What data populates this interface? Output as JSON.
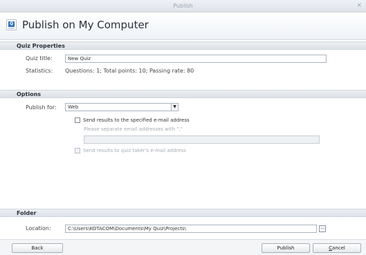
{
  "window": {
    "title": "Publish",
    "close_glyph": "×"
  },
  "header": {
    "icon": "quiz-app-icon",
    "icon_letter": "Q",
    "title": "Publish on My Computer"
  },
  "quiz_properties": {
    "section_title": "Quiz Properties",
    "quiz_title_label": "Quiz title:",
    "quiz_title_value": "New Quiz",
    "statistics_label": "Statistics:",
    "statistics_value": "Questions: 1;   Total points: 10;   Passing rate: 80"
  },
  "options": {
    "section_title": "Options",
    "publish_for_label": "Publish for:",
    "publish_for_value": "Web",
    "send_results_label": "Send results to the specified e-mail address",
    "email_hint": "Please separate email addresses with \",\"",
    "email_value": "",
    "send_taker_label": "Send results to quiz taker's e-mail address"
  },
  "folder": {
    "section_title": "Folder",
    "location_label": "Location:",
    "location_value": "C:\\Users\\KOTACOM\\Documents\\My Quiz\\Projects\\",
    "browse_label": "..."
  },
  "footer": {
    "back_label": "Back",
    "publish_label": "Publish",
    "cancel_label": "Cancel"
  },
  "colors": {
    "section_bar": "#e3e7ec",
    "accent": "#2f6fb8"
  }
}
